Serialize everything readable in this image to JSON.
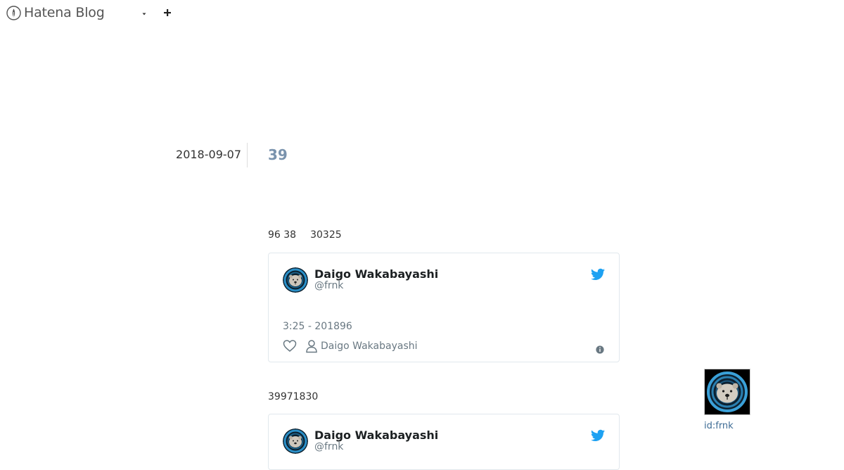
{
  "header": {
    "logo_text": "Hatena Blog",
    "logo_icon": "hatena-logo-icon",
    "menu_icon": "caret-down-icon",
    "add_icon": "plus-icon"
  },
  "entry": {
    "date": "2018-09-07",
    "title": "39",
    "paragraph1_a": "96 38",
    "paragraph1_b": "30325",
    "paragraph2": "39971830"
  },
  "tweets": [
    {
      "name": "Daigo Wakabayashi",
      "handle": "@frnk",
      "time": "3:25 - 201896",
      "person_label": "Daigo Wakabayashi"
    },
    {
      "name": "Daigo Wakabayashi",
      "handle": "@frnk"
    }
  ],
  "profile": {
    "id": "id:frnk"
  },
  "colors": {
    "title_link": "#7a93ad",
    "twitter_blue": "#1da1f2",
    "muted_text": "#697882",
    "profile_link": "#3d6b94"
  }
}
